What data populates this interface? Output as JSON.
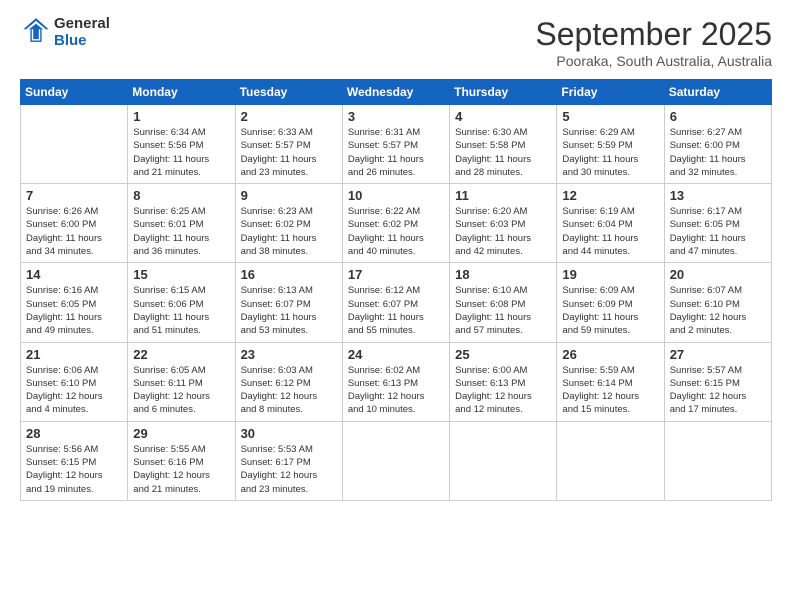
{
  "header": {
    "logo_line1": "General",
    "logo_line2": "Blue",
    "month": "September 2025",
    "location": "Pooraka, South Australia, Australia"
  },
  "days_of_week": [
    "Sunday",
    "Monday",
    "Tuesday",
    "Wednesday",
    "Thursday",
    "Friday",
    "Saturday"
  ],
  "weeks": [
    [
      {
        "day": "",
        "info": ""
      },
      {
        "day": "1",
        "info": "Sunrise: 6:34 AM\nSunset: 5:56 PM\nDaylight: 11 hours\nand 21 minutes."
      },
      {
        "day": "2",
        "info": "Sunrise: 6:33 AM\nSunset: 5:57 PM\nDaylight: 11 hours\nand 23 minutes."
      },
      {
        "day": "3",
        "info": "Sunrise: 6:31 AM\nSunset: 5:57 PM\nDaylight: 11 hours\nand 26 minutes."
      },
      {
        "day": "4",
        "info": "Sunrise: 6:30 AM\nSunset: 5:58 PM\nDaylight: 11 hours\nand 28 minutes."
      },
      {
        "day": "5",
        "info": "Sunrise: 6:29 AM\nSunset: 5:59 PM\nDaylight: 11 hours\nand 30 minutes."
      },
      {
        "day": "6",
        "info": "Sunrise: 6:27 AM\nSunset: 6:00 PM\nDaylight: 11 hours\nand 32 minutes."
      }
    ],
    [
      {
        "day": "7",
        "info": "Sunrise: 6:26 AM\nSunset: 6:00 PM\nDaylight: 11 hours\nand 34 minutes."
      },
      {
        "day": "8",
        "info": "Sunrise: 6:25 AM\nSunset: 6:01 PM\nDaylight: 11 hours\nand 36 minutes."
      },
      {
        "day": "9",
        "info": "Sunrise: 6:23 AM\nSunset: 6:02 PM\nDaylight: 11 hours\nand 38 minutes."
      },
      {
        "day": "10",
        "info": "Sunrise: 6:22 AM\nSunset: 6:02 PM\nDaylight: 11 hours\nand 40 minutes."
      },
      {
        "day": "11",
        "info": "Sunrise: 6:20 AM\nSunset: 6:03 PM\nDaylight: 11 hours\nand 42 minutes."
      },
      {
        "day": "12",
        "info": "Sunrise: 6:19 AM\nSunset: 6:04 PM\nDaylight: 11 hours\nand 44 minutes."
      },
      {
        "day": "13",
        "info": "Sunrise: 6:17 AM\nSunset: 6:05 PM\nDaylight: 11 hours\nand 47 minutes."
      }
    ],
    [
      {
        "day": "14",
        "info": "Sunrise: 6:16 AM\nSunset: 6:05 PM\nDaylight: 11 hours\nand 49 minutes."
      },
      {
        "day": "15",
        "info": "Sunrise: 6:15 AM\nSunset: 6:06 PM\nDaylight: 11 hours\nand 51 minutes."
      },
      {
        "day": "16",
        "info": "Sunrise: 6:13 AM\nSunset: 6:07 PM\nDaylight: 11 hours\nand 53 minutes."
      },
      {
        "day": "17",
        "info": "Sunrise: 6:12 AM\nSunset: 6:07 PM\nDaylight: 11 hours\nand 55 minutes."
      },
      {
        "day": "18",
        "info": "Sunrise: 6:10 AM\nSunset: 6:08 PM\nDaylight: 11 hours\nand 57 minutes."
      },
      {
        "day": "19",
        "info": "Sunrise: 6:09 AM\nSunset: 6:09 PM\nDaylight: 11 hours\nand 59 minutes."
      },
      {
        "day": "20",
        "info": "Sunrise: 6:07 AM\nSunset: 6:10 PM\nDaylight: 12 hours\nand 2 minutes."
      }
    ],
    [
      {
        "day": "21",
        "info": "Sunrise: 6:06 AM\nSunset: 6:10 PM\nDaylight: 12 hours\nand 4 minutes."
      },
      {
        "day": "22",
        "info": "Sunrise: 6:05 AM\nSunset: 6:11 PM\nDaylight: 12 hours\nand 6 minutes."
      },
      {
        "day": "23",
        "info": "Sunrise: 6:03 AM\nSunset: 6:12 PM\nDaylight: 12 hours\nand 8 minutes."
      },
      {
        "day": "24",
        "info": "Sunrise: 6:02 AM\nSunset: 6:13 PM\nDaylight: 12 hours\nand 10 minutes."
      },
      {
        "day": "25",
        "info": "Sunrise: 6:00 AM\nSunset: 6:13 PM\nDaylight: 12 hours\nand 12 minutes."
      },
      {
        "day": "26",
        "info": "Sunrise: 5:59 AM\nSunset: 6:14 PM\nDaylight: 12 hours\nand 15 minutes."
      },
      {
        "day": "27",
        "info": "Sunrise: 5:57 AM\nSunset: 6:15 PM\nDaylight: 12 hours\nand 17 minutes."
      }
    ],
    [
      {
        "day": "28",
        "info": "Sunrise: 5:56 AM\nSunset: 6:15 PM\nDaylight: 12 hours\nand 19 minutes."
      },
      {
        "day": "29",
        "info": "Sunrise: 5:55 AM\nSunset: 6:16 PM\nDaylight: 12 hours\nand 21 minutes."
      },
      {
        "day": "30",
        "info": "Sunrise: 5:53 AM\nSunset: 6:17 PM\nDaylight: 12 hours\nand 23 minutes."
      },
      {
        "day": "",
        "info": ""
      },
      {
        "day": "",
        "info": ""
      },
      {
        "day": "",
        "info": ""
      },
      {
        "day": "",
        "info": ""
      }
    ]
  ]
}
